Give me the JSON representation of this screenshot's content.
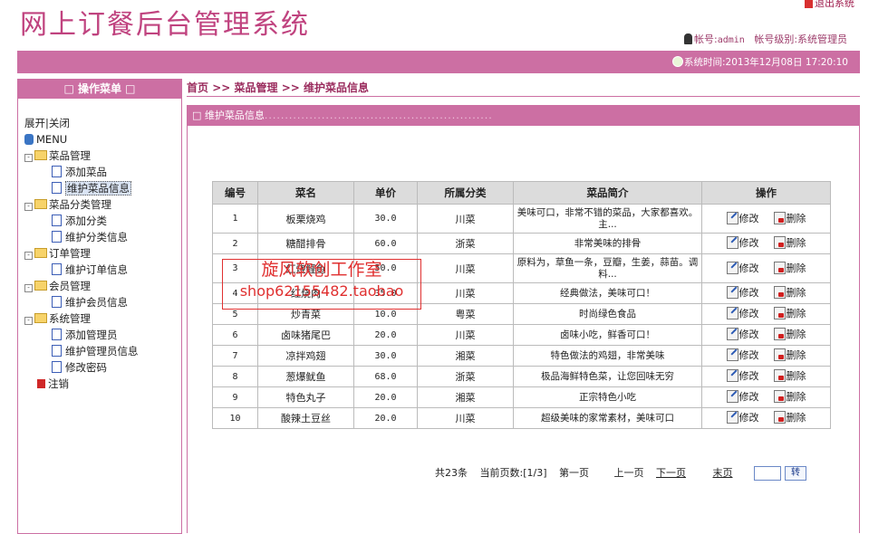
{
  "header": {
    "title": "网上订餐后台管理系统",
    "logout": "退出系统",
    "account_label": "帐号:",
    "account_value": "admin",
    "level_label": "帐号级别:",
    "level_value": "系统管理员",
    "time_label": "系统时间:",
    "time_value": "2013年12月08日 17:20:10"
  },
  "sidebar": {
    "header": "□ 操作菜单 □",
    "expand": "展开",
    "separator": "|",
    "collapse": "关闭",
    "root": "MENU",
    "groups": [
      {
        "label": "菜品管理",
        "items": [
          "添加菜品",
          "维护菜品信息"
        ]
      },
      {
        "label": "菜品分类管理",
        "items": [
          "添加分类",
          "维护分类信息"
        ]
      },
      {
        "label": "订单管理",
        "items": [
          "维护订单信息"
        ]
      },
      {
        "label": "会员管理",
        "items": [
          "维护会员信息"
        ]
      },
      {
        "label": "系统管理",
        "items": [
          "添加管理员",
          "维护管理员信息",
          "修改密码"
        ]
      }
    ],
    "logout": "注销"
  },
  "breadcrumb": {
    "home": "首页",
    "sep": ">>",
    "level1": "菜品管理",
    "level2": "维护菜品信息"
  },
  "panel": {
    "title": "□ 维护菜品信息",
    "dots": "........................................................"
  },
  "table": {
    "headers": [
      "编号",
      "菜名",
      "单价",
      "所属分类",
      "菜品简介",
      "操作"
    ],
    "edit_label": "修改",
    "delete_label": "删除",
    "rows": [
      [
        "1",
        "板栗烧鸡",
        "30.0",
        "川菜",
        "美味可口，非常不错的菜品，大家都喜欢。主..."
      ],
      [
        "2",
        "糖醋排骨",
        "60.0",
        "浙菜",
        "非常美味的排骨"
      ],
      [
        "3",
        "红烧鲤鱼",
        "50.0",
        "川菜",
        "原料为，草鱼一条，豆瓣，生姜，蒜苗。调料..."
      ],
      [
        "4",
        "红烧肉",
        "35.0",
        "川菜",
        "经典做法，美味可口！"
      ],
      [
        "5",
        "炒青菜",
        "10.0",
        "粤菜",
        "时尚绿色食品"
      ],
      [
        "6",
        "卤味猪尾巴",
        "20.0",
        "川菜",
        "卤味小吃，鲜香可口！"
      ],
      [
        "7",
        "凉拌鸡翅",
        "30.0",
        "湘菜",
        "特色做法的鸡翅，非常美味"
      ],
      [
        "8",
        "葱爆鱿鱼",
        "68.0",
        "浙菜",
        "极品海鲜特色菜，让您回味无穷"
      ],
      [
        "9",
        "特色丸子",
        "20.0",
        "湘菜",
        "正宗特色小吃"
      ],
      [
        "10",
        "酸辣土豆丝",
        "20.0",
        "川菜",
        "超级美味的家常素材，美味可口"
      ]
    ]
  },
  "pager": {
    "total": "共23条",
    "current_label": "当前页数:",
    "current_value": "[1/3]",
    "first": "第一页",
    "prev": "上一页",
    "next": "下一页",
    "last": "末页",
    "go": "转"
  },
  "watermark": {
    "line1": "旋风软创工作室",
    "line2": "shop62155482.taobao"
  }
}
